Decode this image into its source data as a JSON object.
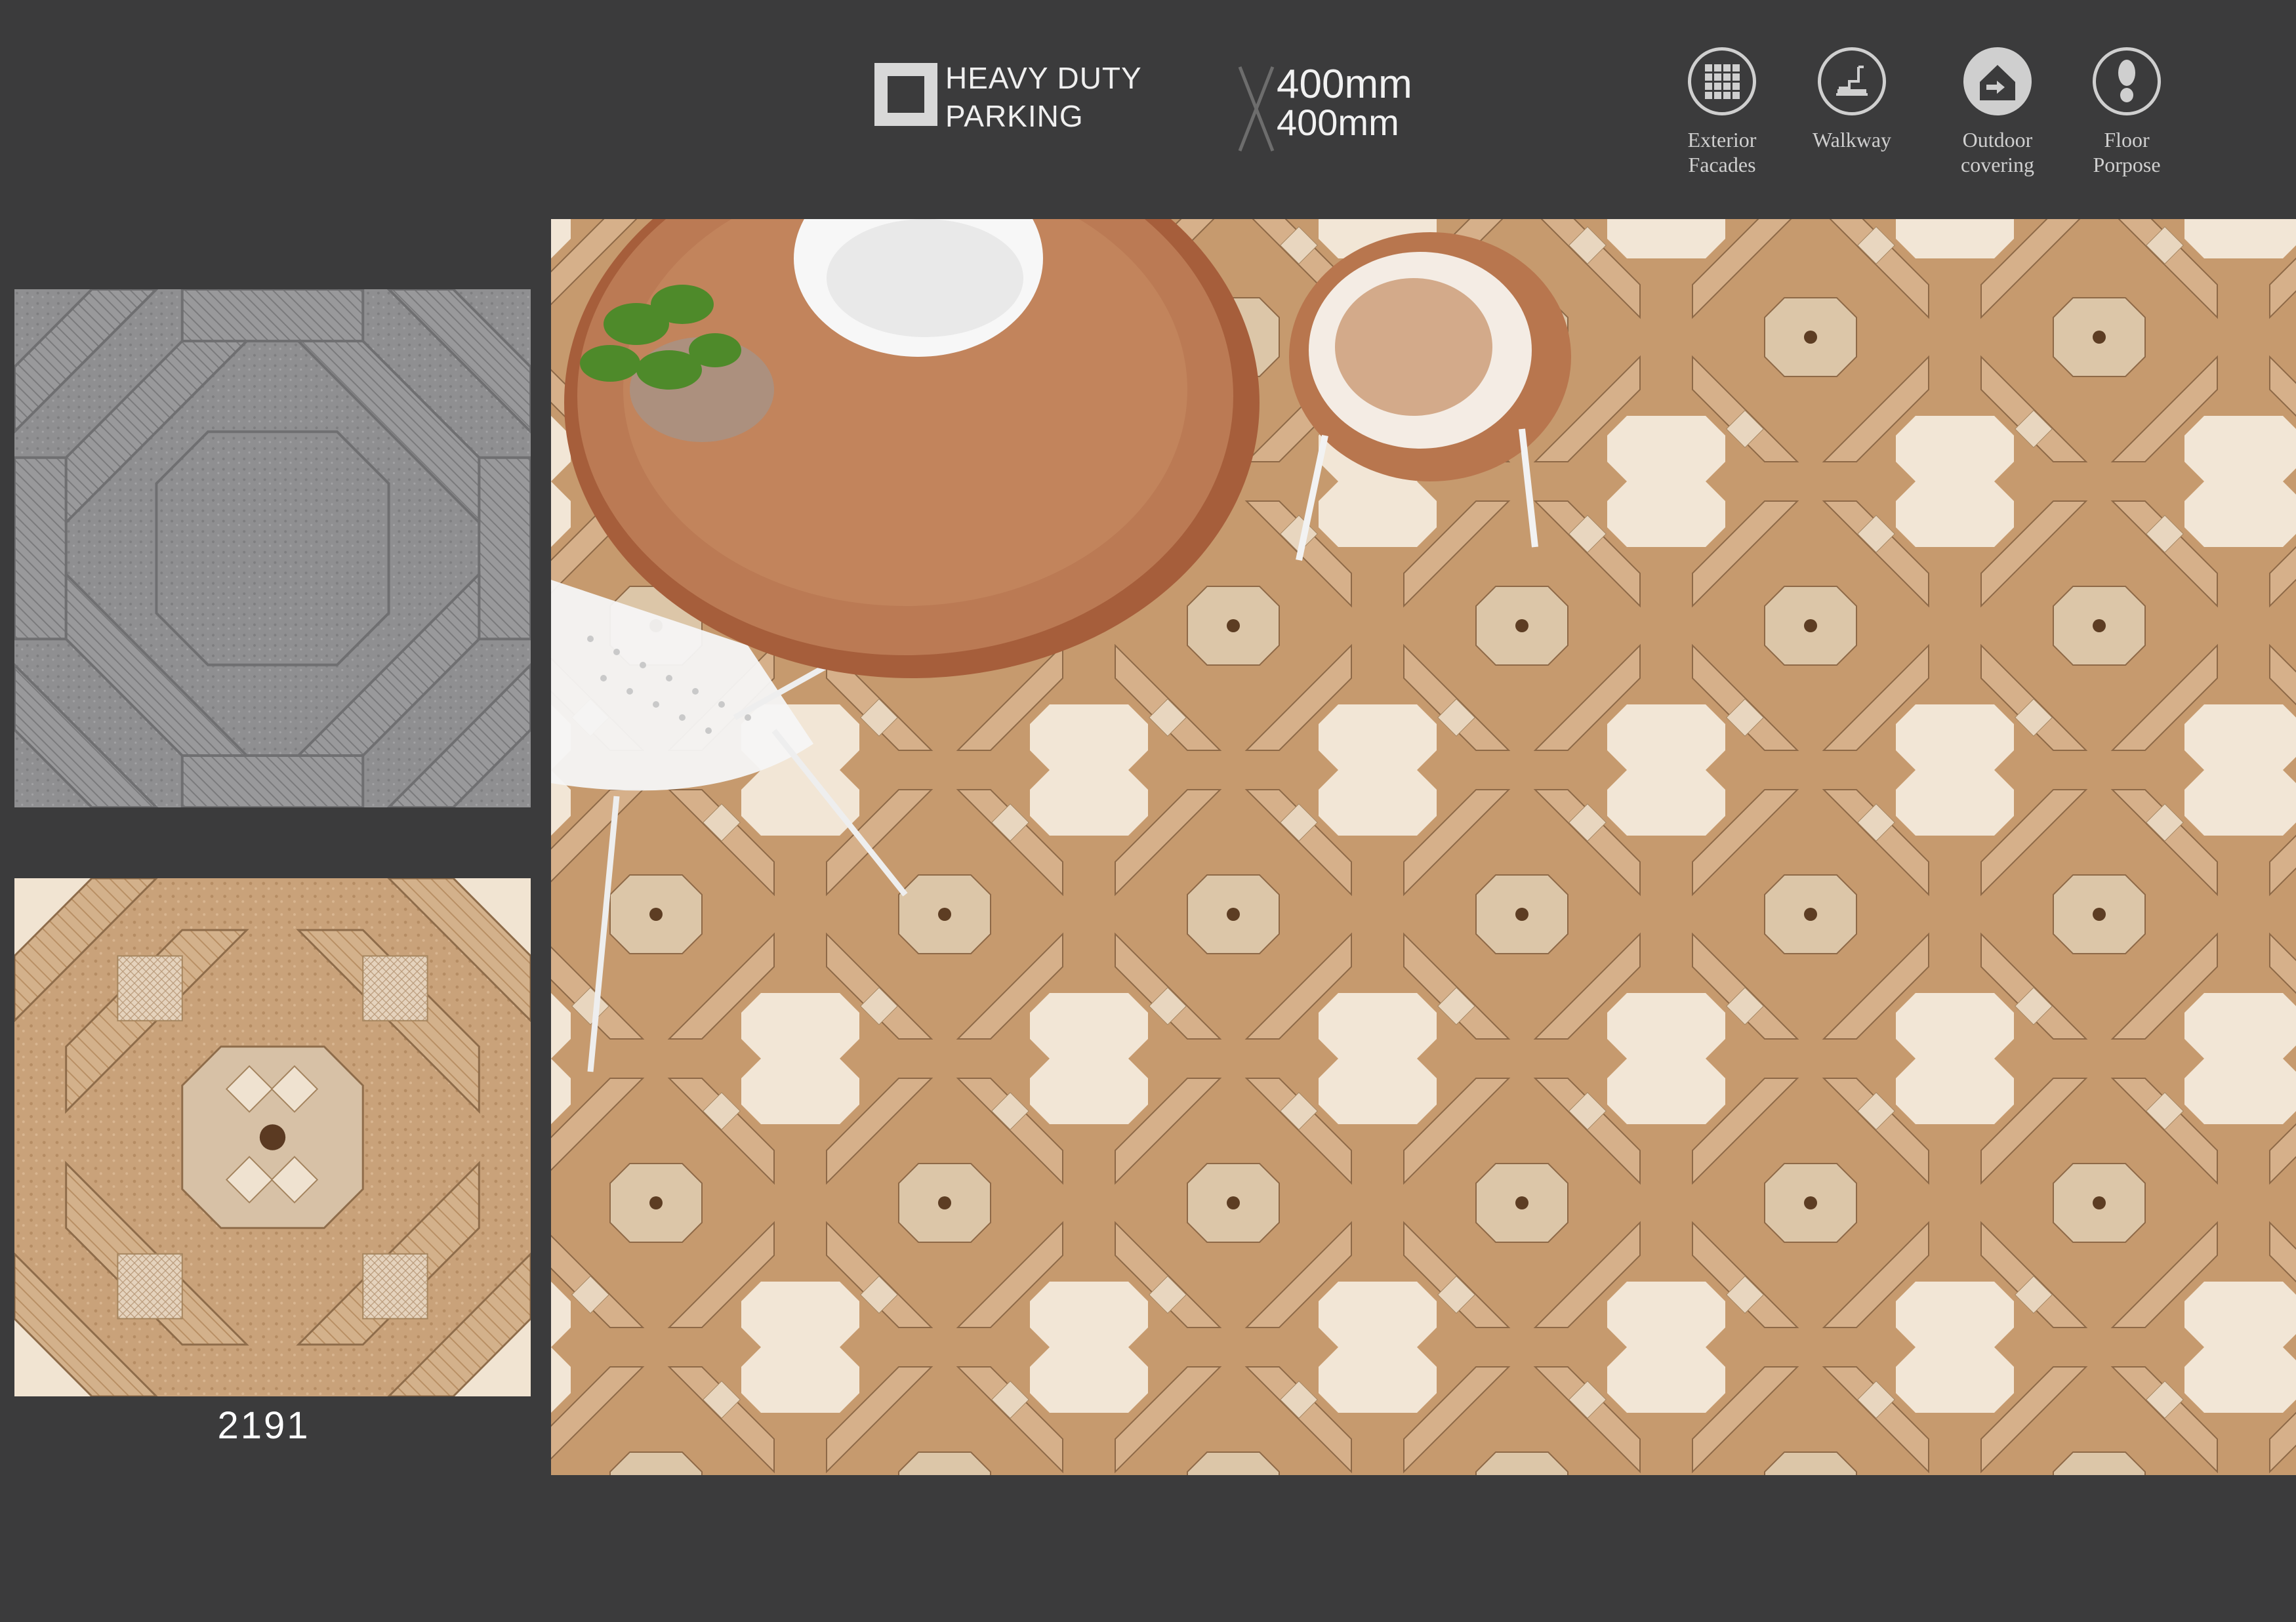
{
  "header": {
    "feature_line1": "HEAVY DUTY",
    "feature_line2": "PARKING",
    "size_line1": "400mm",
    "size_line2": "400mm",
    "usage": [
      {
        "line1": "Exterior",
        "line2": "Facades",
        "icon": "grid-facade-icon"
      },
      {
        "line1": "Walkway",
        "line2": "",
        "icon": "steps-icon"
      },
      {
        "line1": "Outdoor",
        "line2": "covering",
        "icon": "house-icon"
      },
      {
        "line1": "Floor",
        "line2": "Porpose",
        "icon": "footprint-icon"
      }
    ]
  },
  "product": {
    "code": "2191"
  },
  "colors": {
    "background": "#3b3b3c",
    "tile_beige": "#c9a27a",
    "tile_cream": "#f3e8da",
    "tile_gray": "#8e8e90"
  }
}
